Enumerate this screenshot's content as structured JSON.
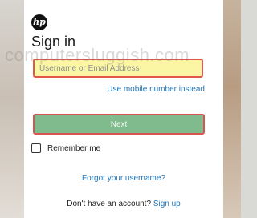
{
  "brand": {
    "logo_text": "hp"
  },
  "signin": {
    "title": "Sign in",
    "email_placeholder": "Username or Email Address",
    "mobile_link": "Use mobile number instead",
    "next_label": "Next",
    "remember_label": "Remember me",
    "forgot_link": "Forgot your username?",
    "no_account_text": "Don't have an account?",
    "signup_link": "Sign up"
  },
  "watermark": "computersluggish.com",
  "colors": {
    "input_bg": "#fbf6a3",
    "input_border": "#e0584c",
    "next_bg": "#80bb8d",
    "link": "#1f73b7"
  }
}
